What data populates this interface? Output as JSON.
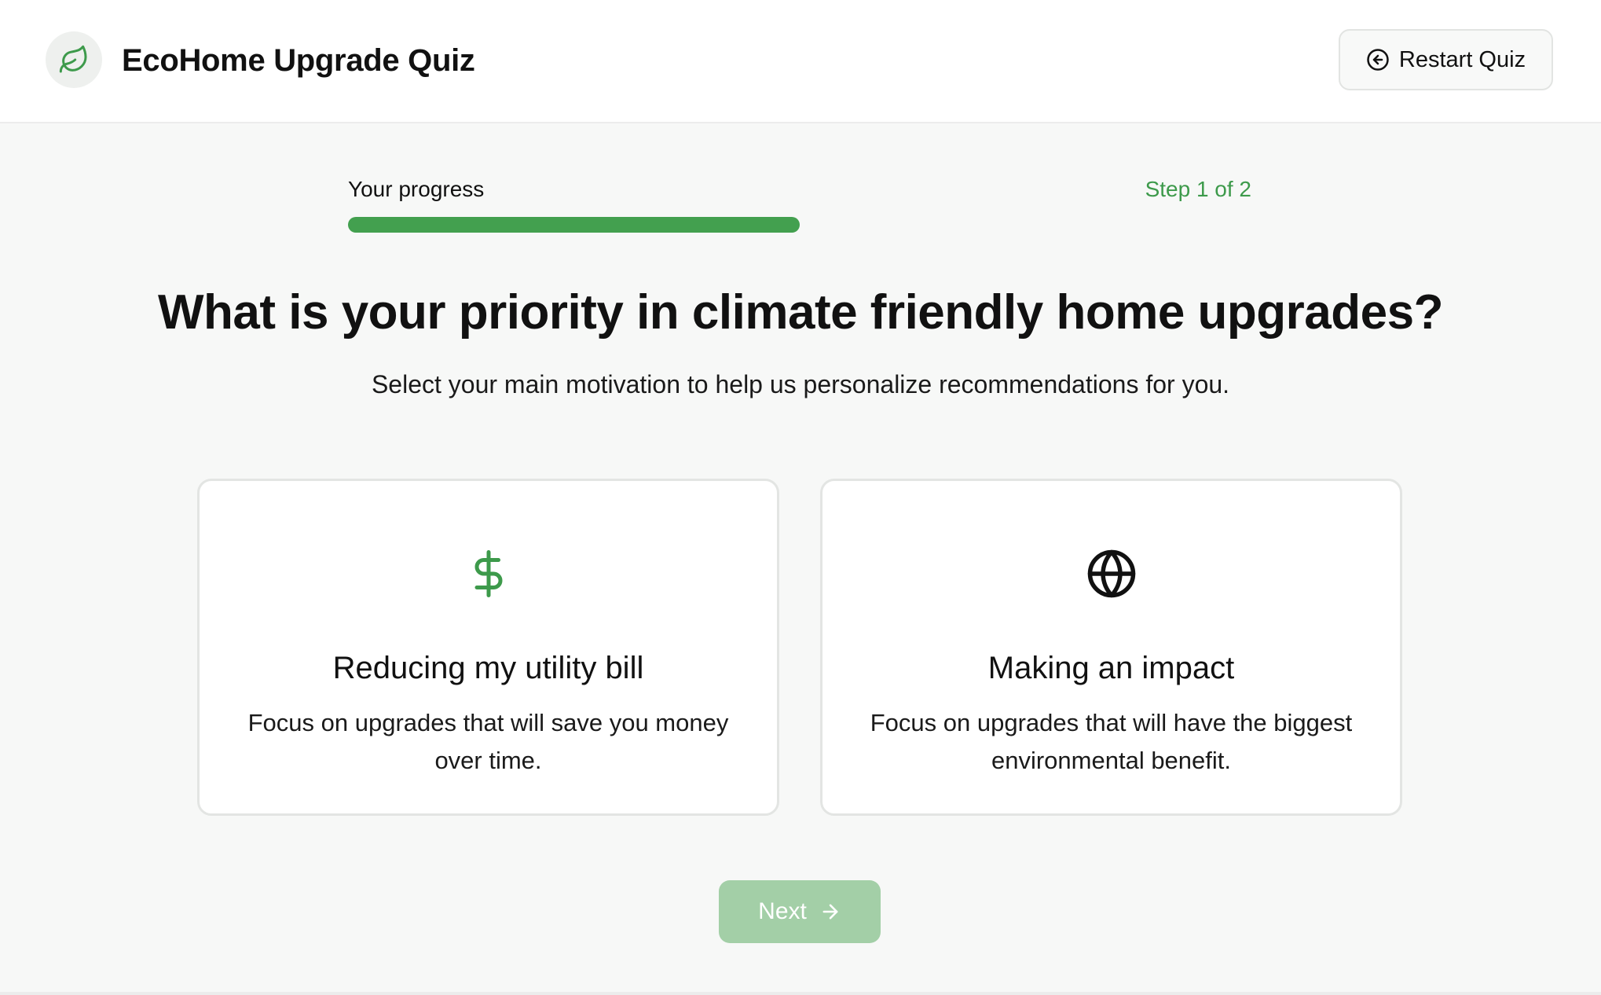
{
  "header": {
    "logo_icon": "leaf-icon",
    "title": "EcoHome Upgrade Quiz",
    "restart_label": "Restart Quiz",
    "restart_icon": "circle-arrow-left-icon"
  },
  "progress": {
    "label": "Your progress",
    "step_text": "Step 1 of 2",
    "value_percent": 50
  },
  "question": {
    "title": "What is your priority in climate friendly home upgrades?",
    "subtitle": "Select your main motivation to help us personalize recommendations for you."
  },
  "options": [
    {
      "icon": "dollar-icon",
      "title": "Reducing my utility bill",
      "description": "Focus on upgrades that will save you money over time."
    },
    {
      "icon": "globe-icon",
      "title": "Making an impact",
      "description": "Focus on upgrades that will have the biggest environmental benefit."
    }
  ],
  "footer": {
    "next_label": "Next",
    "next_icon": "arrow-right-icon"
  },
  "colors": {
    "accent": "#43a04f",
    "accent_text": "#3d9a4b",
    "next_disabled": "#a3cfa7"
  }
}
